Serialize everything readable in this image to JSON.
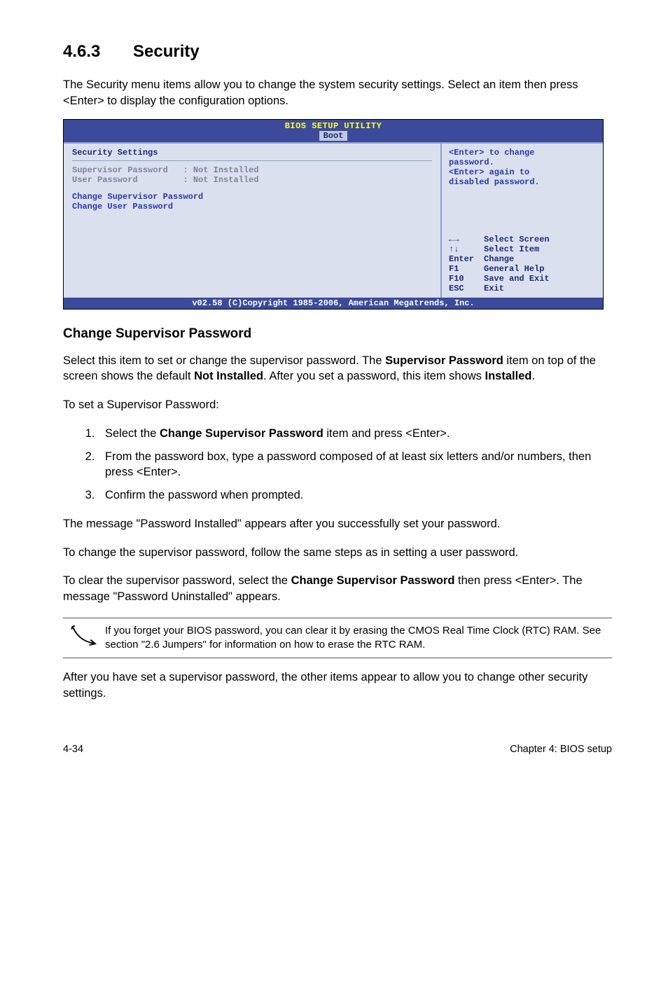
{
  "section": {
    "number": "4.6.3",
    "title": "Security"
  },
  "intro": "The Security menu items allow you to change the system security settings. Select an item then press <Enter> to display the configuration options.",
  "bios": {
    "title": "BIOS SETUP UTILITY",
    "tab": "Boot",
    "heading": "Security Settings",
    "rows": {
      "sup_label": "Supervisor Password",
      "sup_val": ": Not Installed",
      "user_label": "User Password",
      "user_val": ": Not Installed"
    },
    "items": {
      "change_sup": "Change Supervisor Password",
      "change_user": "Change User Password"
    },
    "help": {
      "l1": "<Enter> to change",
      "l2": "password.",
      "l3": "<Enter> again to",
      "l4": "disabled password."
    },
    "nav": {
      "arrows_lr": "←→",
      "arrows_ud": "↑↓",
      "enter_key": "Enter",
      "f1": "F1",
      "f10": "F10",
      "esc": "ESC",
      "select_screen": "Select Screen",
      "select_item": "Select Item",
      "change": "Change",
      "general_help": "General Help",
      "save_exit": "Save and Exit",
      "exit": "Exit"
    },
    "copyright": "v02.58 (C)Copyright 1985-2006, American Megatrends, Inc."
  },
  "subhead": "Change Supervisor Password",
  "para1_a": "Select this item to set or change the supervisor password. The ",
  "para1_b": "Supervisor Password",
  "para1_c": " item on top of the screen shows the default ",
  "para1_d": "Not Installed",
  "para1_e": ". After you set a password, this item shows ",
  "para1_f": "Installed",
  "para1_g": ".",
  "para2": "To set a Supervisor Password:",
  "steps": {
    "s1a": "Select the ",
    "s1b": "Change Supervisor Password",
    "s1c": " item and press <Enter>.",
    "s2": "From the password box, type a password composed of at least six letters and/or numbers, then press <Enter>.",
    "s3": "Confirm the password when prompted."
  },
  "para3": "The message \"Password Installed\" appears after you successfully set your password.",
  "para4": "To change the supervisor password, follow the same steps as in setting a user password.",
  "para5_a": "To clear the supervisor password, select the ",
  "para5_b": "Change Supervisor Password",
  "para5_c": " then press <Enter>. The message \"Password Uninstalled\" appears.",
  "note": "If you forget your BIOS password, you can clear it by erasing the CMOS Real Time Clock (RTC) RAM. See section \"2.6 Jumpers\" for information on how to erase the RTC RAM.",
  "para6": "After you have set a supervisor password, the other items appear to allow you to change other security settings.",
  "footer": {
    "left": "4-34",
    "right": "Chapter 4: BIOS setup"
  }
}
